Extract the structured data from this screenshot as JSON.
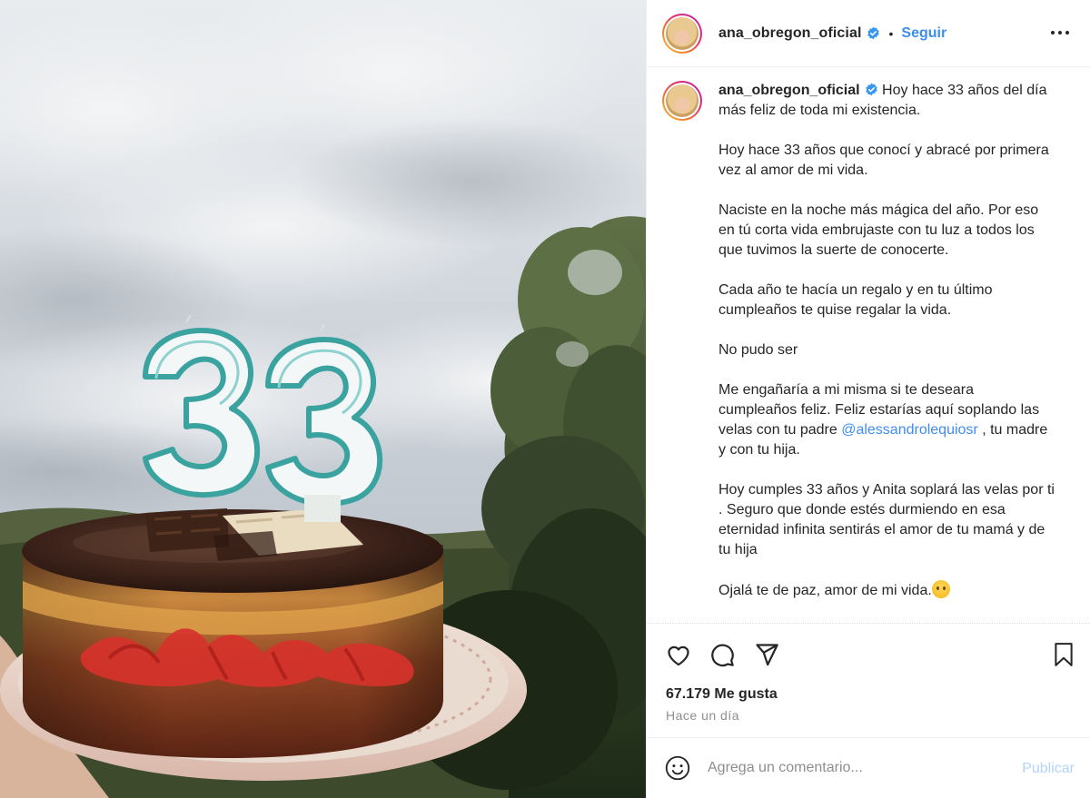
{
  "post": {
    "username": "ana_obregon_oficial",
    "verified": true,
    "follow_label": "Seguir",
    "separator": "•",
    "more_icon": "more-horizontal-icon",
    "photo_description_icon": "cake-photo"
  },
  "caption": {
    "first_line": "Hoy hace 33 años del día más feliz de toda mi existencia.",
    "paragraphs": [
      "Hoy hace 33 años que conocí y abracé por primera vez al amor de mi vida.",
      "Naciste en la noche más mágica del año. Por eso en tú corta vida embrujaste con tu luz a todos los que tuvimos la suerte de conocerte.",
      "Cada año te hacía un regalo y en tu último cumpleaños te quise regalar la vida.",
      "No pudo ser"
    ],
    "para_mention_before": "Me engañaría a mi misma si te deseara cumpleaños feliz. Feliz estarías aquí soplando las velas con tu padre",
    "mention": "@alessandrolequiosr",
    "para_mention_after": ", tu madre y con tu hija.",
    "para_anita": "Hoy cumples 33 años y Anita soplará las velas por ti . Seguro que donde estés durmiendo en esa eternidad infinita sentirás el amor de tu mamá y de tu hija",
    "last_line": "Ojalá te de paz, amor de mi vida."
  },
  "actions": {
    "like_icon": "heart-icon",
    "comment_icon": "comment-icon",
    "share_icon": "share-icon",
    "save_icon": "bookmark-icon"
  },
  "stats": {
    "likes": "67.179 Me gusta",
    "time": "Hace un día"
  },
  "comment": {
    "emoji_icon": "emoji-icon",
    "placeholder": "Agrega un comentario...",
    "publish_label": "Publicar"
  },
  "colors": {
    "accent": "#3e8ef0",
    "publish_disabled": "#b3d4fb",
    "text": "#262626",
    "muted": "#8e8e8e"
  }
}
